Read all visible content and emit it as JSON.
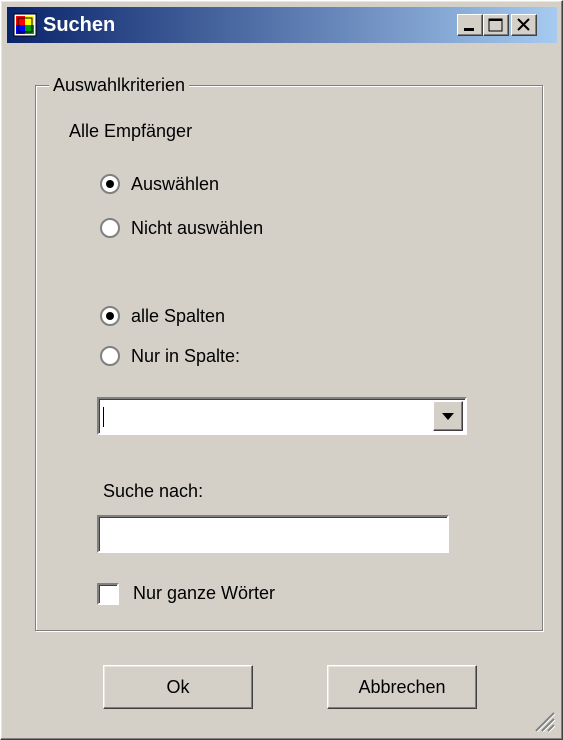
{
  "window": {
    "title": "Suchen"
  },
  "group": {
    "legend": "Auswahlkriterien",
    "recipients_label": "Alle Empfänger",
    "recipient_options": [
      {
        "label": "Auswählen",
        "checked": true
      },
      {
        "label": "Nicht auswählen",
        "checked": false
      }
    ],
    "column_options": [
      {
        "label": "alle Spalten",
        "checked": true
      },
      {
        "label": "Nur in Spalte:",
        "checked": false
      }
    ],
    "column_select_value": "",
    "search_label": "Suche nach:",
    "search_value": "",
    "whole_words_label": "Nur ganze Wörter",
    "whole_words_checked": false
  },
  "buttons": {
    "ok": "Ok",
    "cancel": "Abbrechen"
  },
  "colors": {
    "face": "#d4d0c8",
    "title_start": "#0a246a",
    "title_end": "#a6caf0"
  }
}
